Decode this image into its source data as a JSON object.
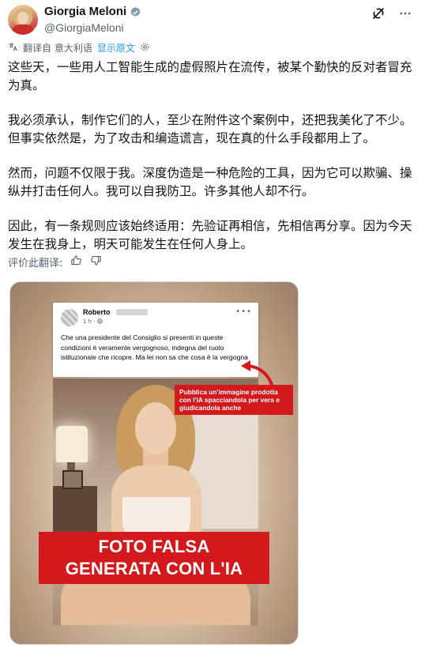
{
  "author": {
    "name": "Giorgia Meloni",
    "handle": "@GiorgiaMeloni"
  },
  "translate_bar": {
    "label": "翻译自 意大利语",
    "link": "显示原文"
  },
  "tweet": {
    "paragraphs": [
      "这些天，一些用人工智能生成的虚假照片在流传，被某个勤快的反对者冒充为真。",
      "我必须承认，制作它们的人，至少在附件这个案例中，还把我美化了不少。但事实依然是，为了攻击和编造谎言，现在真的什么手段都用上了。",
      "然而，问题不仅限于我。深度伪造是一种危险的工具，因为它可以欺骗、操纵并打击任何人。我可以自我防卫。许多其他人却不行。",
      "因此，有一条规则应该始终适用：先验证再相信，先相信再分享。因为今天发生在我身上，明天可能发生在任何人身上。"
    ]
  },
  "rate_translation": {
    "label": "评价此翻译:"
  },
  "media": {
    "fb_post": {
      "name": "Roberto",
      "time": "1 h ·",
      "text": "Che una presidente del Consiglio  si presenti in queste condizioni è veramente vergognoso, indegna del ruolo istituzionale che ricopre. Ma lei non sa che cosa è la vergogna"
    },
    "red_note": "Pubblica un'immagine prodotta con l'IA spacciandola per vera e giudicandola anche",
    "banner_line1": "FOTO FALSA",
    "banner_line2": "GENERATA CON L'IA"
  },
  "colors": {
    "accent": "#1d9bf0",
    "verified": "#829aab",
    "alert_red": "#d3191c"
  },
  "icons": [
    "verified-badge-icon",
    "grok-icon",
    "more-icon",
    "translate-icon",
    "settings-icon",
    "thumbs-up-icon",
    "thumbs-down-icon"
  ]
}
